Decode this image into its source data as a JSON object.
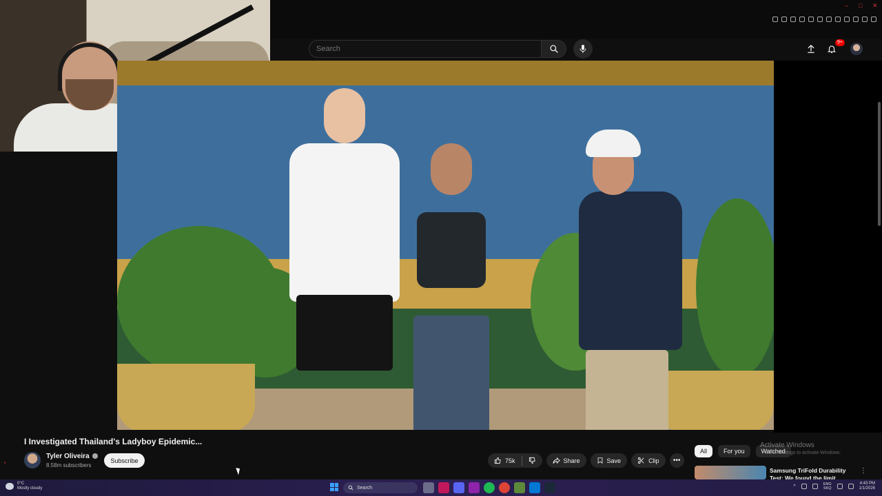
{
  "browser": {
    "window_controls": [
      "–",
      "□",
      "✕"
    ]
  },
  "header": {
    "search_placeholder": "Search",
    "notification_badge": "9+"
  },
  "video": {
    "title": "I Investigated Thailand's Ladyboy Epidemic...",
    "channel_name": "Tyler Oliveira",
    "subscribers": "8.58m subscribers",
    "subscribe_label": "Subscribe",
    "likes": "75k",
    "share_label": "Share",
    "save_label": "Save",
    "clip_label": "Clip",
    "more_label": "•••"
  },
  "related": {
    "chips": [
      "All",
      "For you",
      "Watched"
    ],
    "active_chip": "All",
    "first_video_title": "Samsung TriFold Durability Test: We found the limit"
  },
  "watermark": {
    "line1": "Activate Windows",
    "line2": "Go to Settings to activate Windows."
  },
  "taskbar": {
    "weather_temp": "0°C",
    "weather_desc": "Mostly cloudy",
    "search_label": "Search",
    "lang_line1": "ENG",
    "lang_line2": "SKQ",
    "time": "4:43 PM",
    "date": "1/1/2026"
  },
  "colors": {
    "bg": "#0f0f0f",
    "pill": "#272727",
    "badge": "#ee0000",
    "taskbar": "#2c1f52"
  }
}
